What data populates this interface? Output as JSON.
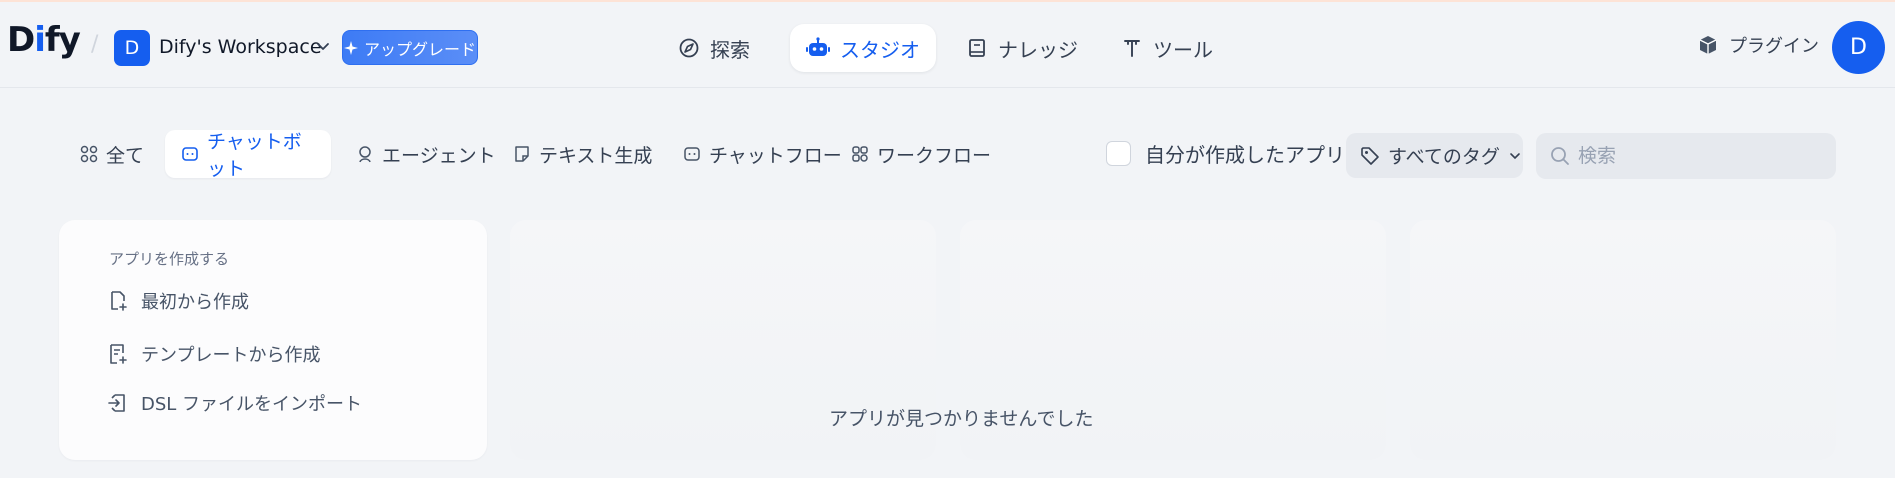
{
  "header": {
    "logo": {
      "main": "D",
      "accent": "i",
      "rest": "fy"
    },
    "workspace": {
      "initial": "D",
      "name": "Dify's Workspace"
    },
    "upgrade_label": "アップグレード",
    "nav": [
      {
        "label": "探索",
        "icon": "compass-icon"
      },
      {
        "label": "スタジオ",
        "icon": "robot-icon",
        "active": true
      },
      {
        "label": "ナレッジ",
        "icon": "book-icon"
      },
      {
        "label": "ツール",
        "icon": "tool-icon"
      }
    ],
    "plugin_label": "プラグイン",
    "user_initial": "D"
  },
  "filters": {
    "tabs": [
      {
        "label": "全て",
        "icon": "grid-icon"
      },
      {
        "label": "チャットボット",
        "icon": "chatbot-icon",
        "active": true
      },
      {
        "label": "エージェント",
        "icon": "agent-icon"
      },
      {
        "label": "テキスト生成",
        "icon": "text-generation-icon"
      },
      {
        "label": "チャットフロー",
        "icon": "chatflow-icon"
      },
      {
        "label": "ワークフロー",
        "icon": "workflow-icon"
      }
    ],
    "mine_label": "自分が作成したアプリ",
    "mine_checked": false,
    "tags_label": "すべてのタグ",
    "search_placeholder": "検索",
    "search_value": ""
  },
  "create_card": {
    "title": "アプリを作成する",
    "items": [
      {
        "label": "最初から作成",
        "icon": "new-file-icon"
      },
      {
        "label": "テンプレートから作成",
        "icon": "template-icon"
      },
      {
        "label": "DSL ファイルをインポート",
        "icon": "import-icon"
      }
    ]
  },
  "empty_message": "アプリが見つかりませんでした",
  "colors": {
    "accent": "#155eef",
    "background": "#f2f4f7",
    "text": "#354052"
  }
}
